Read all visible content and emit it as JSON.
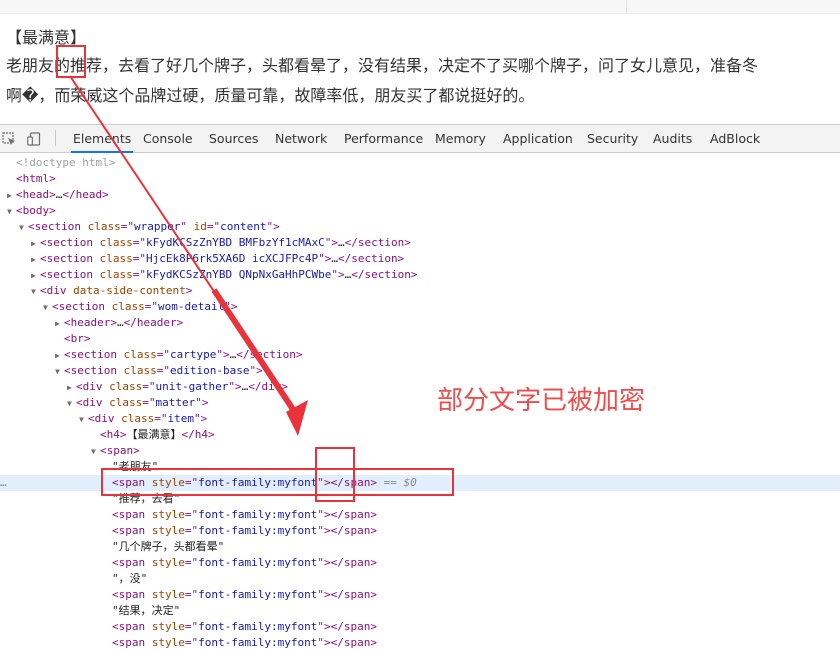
{
  "page": {
    "review_title": "【最满意】",
    "line1": "老朋友的推荐，去看了好几个牌子，头都看晕了，没有结果，决定不了买哪个牌子，问了女儿意见，准备冬",
    "line2": "啊�，而荣威这个品牌过硬，质量可靠，故障率低，朋友买了都说挺好的。"
  },
  "devtools": {
    "tabs": [
      {
        "label": "Elements",
        "active": true
      },
      {
        "label": "Console"
      },
      {
        "label": "Sources"
      },
      {
        "label": "Network"
      },
      {
        "label": "Performance"
      },
      {
        "label": "Memory"
      },
      {
        "label": "Application"
      },
      {
        "label": "Security"
      },
      {
        "label": "Audits"
      },
      {
        "label": "AdBlock"
      }
    ],
    "selected_marker": "== $0",
    "dom_lines": [
      {
        "indent": 0,
        "tri": "",
        "kind": "doctype",
        "text": "<!doctype html>"
      },
      {
        "indent": 0,
        "tri": "",
        "kind": "open",
        "tag": "html"
      },
      {
        "indent": 0,
        "tri": "▶",
        "kind": "collapsed",
        "tag": "head"
      },
      {
        "indent": 0,
        "tri": "▼",
        "kind": "open",
        "tag": "body"
      },
      {
        "indent": 1,
        "tri": "▼",
        "kind": "open",
        "tag": "section",
        "attrs": [
          [
            "class",
            "wrapper"
          ],
          [
            "id",
            "content"
          ]
        ]
      },
      {
        "indent": 2,
        "tri": "▶",
        "kind": "collapsed",
        "tag": "section",
        "attrs": [
          [
            "class",
            "kFydKCSzZnYBD BMFbzYf1cMAxC"
          ]
        ]
      },
      {
        "indent": 2,
        "tri": "▶",
        "kind": "collapsed",
        "tag": "section",
        "attrs": [
          [
            "class",
            "HjcEk8P6rk5XA6D icXCJFPc4P"
          ]
        ]
      },
      {
        "indent": 2,
        "tri": "▶",
        "kind": "collapsed",
        "tag": "section",
        "attrs": [
          [
            "class",
            "kFydKCSzZnYBD QNpNxGaHhPCWbe"
          ]
        ]
      },
      {
        "indent": 2,
        "tri": "▼",
        "kind": "open",
        "tag": "div",
        "attrs": [
          [
            "data-side-content",
            null
          ]
        ]
      },
      {
        "indent": 3,
        "tri": "▼",
        "kind": "open",
        "tag": "section",
        "attrs": [
          [
            "class",
            "wom-detail"
          ]
        ]
      },
      {
        "indent": 4,
        "tri": "▶",
        "kind": "collapsed",
        "tag": "header"
      },
      {
        "indent": 4,
        "tri": "",
        "kind": "open",
        "tag": "br"
      },
      {
        "indent": 4,
        "tri": "▶",
        "kind": "collapsed",
        "tag": "section",
        "attrs": [
          [
            "class",
            "cartype"
          ]
        ]
      },
      {
        "indent": 4,
        "tri": "▼",
        "kind": "open",
        "tag": "section",
        "attrs": [
          [
            "class",
            "edition-base"
          ]
        ]
      },
      {
        "indent": 5,
        "tri": "▶",
        "kind": "collapsed",
        "tag": "div",
        "attrs": [
          [
            "class",
            "unit-gather"
          ]
        ]
      },
      {
        "indent": 5,
        "tri": "▼",
        "kind": "open",
        "tag": "div",
        "attrs": [
          [
            "class",
            "matter"
          ]
        ]
      },
      {
        "indent": 6,
        "tri": "▼",
        "kind": "open",
        "tag": "div",
        "attrs": [
          [
            "class",
            "item"
          ]
        ]
      },
      {
        "indent": 7,
        "tri": "",
        "kind": "inline",
        "tag": "h4",
        "inner": "【最满意】"
      },
      {
        "indent": 7,
        "tri": "▼",
        "kind": "open",
        "tag": "span"
      },
      {
        "indent": 8,
        "tri": "",
        "kind": "text",
        "text": "\"老朋友\""
      },
      {
        "indent": 8,
        "tri": "",
        "kind": "inline",
        "tag": "span",
        "attrs": [
          [
            "style",
            "font-family:myfont"
          ]
        ],
        "inner": "",
        "selected": true
      },
      {
        "indent": 8,
        "tri": "",
        "kind": "text",
        "text": "\"推荐，去看\""
      },
      {
        "indent": 8,
        "tri": "",
        "kind": "inline",
        "tag": "span",
        "attrs": [
          [
            "style",
            "font-family:myfont"
          ]
        ],
        "inner": ""
      },
      {
        "indent": 8,
        "tri": "",
        "kind": "inline",
        "tag": "span",
        "attrs": [
          [
            "style",
            "font-family:myfont"
          ]
        ],
        "inner": ""
      },
      {
        "indent": 8,
        "tri": "",
        "kind": "text",
        "text": "\"几个牌子，头都看晕\""
      },
      {
        "indent": 8,
        "tri": "",
        "kind": "inline",
        "tag": "span",
        "attrs": [
          [
            "style",
            "font-family:myfont"
          ]
        ],
        "inner": ""
      },
      {
        "indent": 8,
        "tri": "",
        "kind": "text",
        "text": "\"，没\""
      },
      {
        "indent": 8,
        "tri": "",
        "kind": "inline",
        "tag": "span",
        "attrs": [
          [
            "style",
            "font-family:myfont"
          ]
        ],
        "inner": ""
      },
      {
        "indent": 8,
        "tri": "",
        "kind": "text",
        "text": "\"结果，决定\""
      },
      {
        "indent": 8,
        "tri": "",
        "kind": "inline",
        "tag": "span",
        "attrs": [
          [
            "style",
            "font-family:myfont"
          ]
        ],
        "inner": ""
      },
      {
        "indent": 8,
        "tri": "",
        "kind": "inline",
        "tag": "span",
        "attrs": [
          [
            "style",
            "font-family:myfont"
          ]
        ],
        "inner": ""
      }
    ]
  },
  "annotation": {
    "text": "部分文字已被加密",
    "color": "#ee4d4d"
  },
  "colors": {
    "highlight_red": "#e8333a",
    "tag": "#881280",
    "attr_name": "#994500",
    "attr_value": "#1a1aa6",
    "selected_row": "#e2eefb",
    "active_tab_underline": "#1a73e8"
  }
}
